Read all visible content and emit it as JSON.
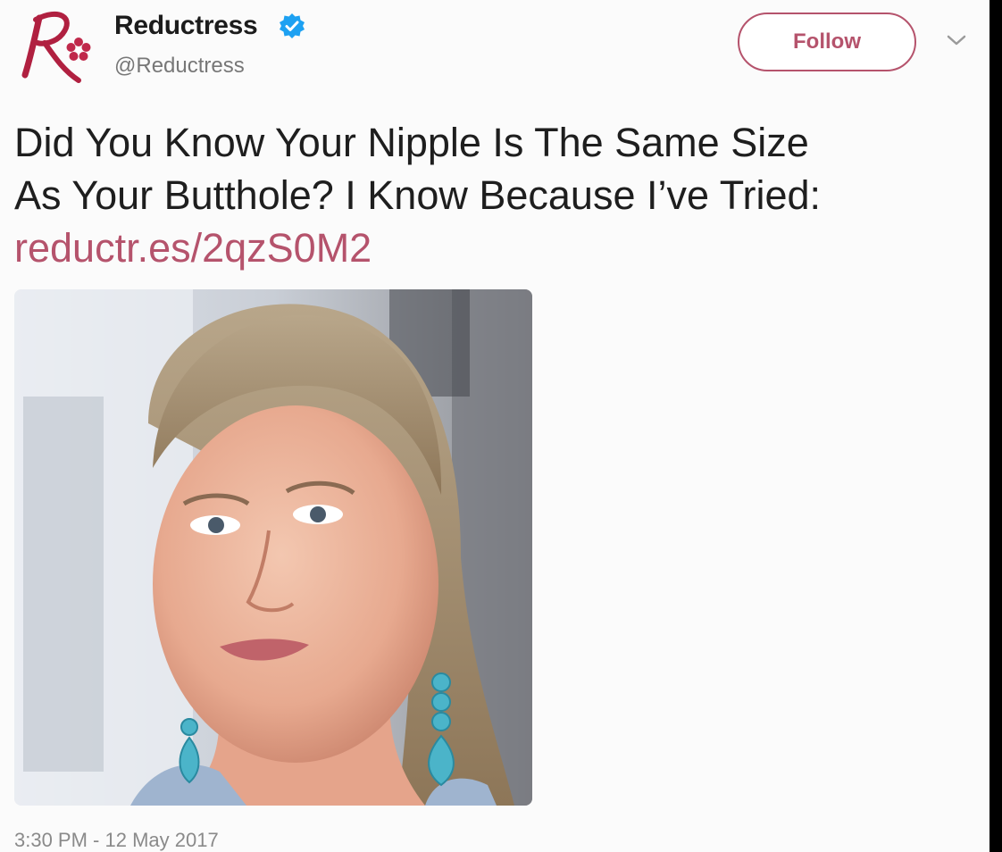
{
  "account": {
    "display_name": "Reductress",
    "handle": "@Reductress",
    "verified_icon": "verified-badge-icon",
    "avatar_icon": "reductress-logo"
  },
  "actions": {
    "follow_label": "Follow",
    "menu_icon": "chevron-down-icon"
  },
  "tweet": {
    "text_line_1": "Did You Know Your Nipple Is The Same Size",
    "text_line_2": "As Your Butthole? I Know Because I’ve Tried:",
    "link": "reductr.es/2qzS0M2",
    "timestamp": "3:30 PM - 12 May 2017"
  },
  "colors": {
    "brand": "#b5536c",
    "verified": "#1da1f2",
    "text": "#1e1e1e",
    "muted": "#8a8a8a"
  }
}
